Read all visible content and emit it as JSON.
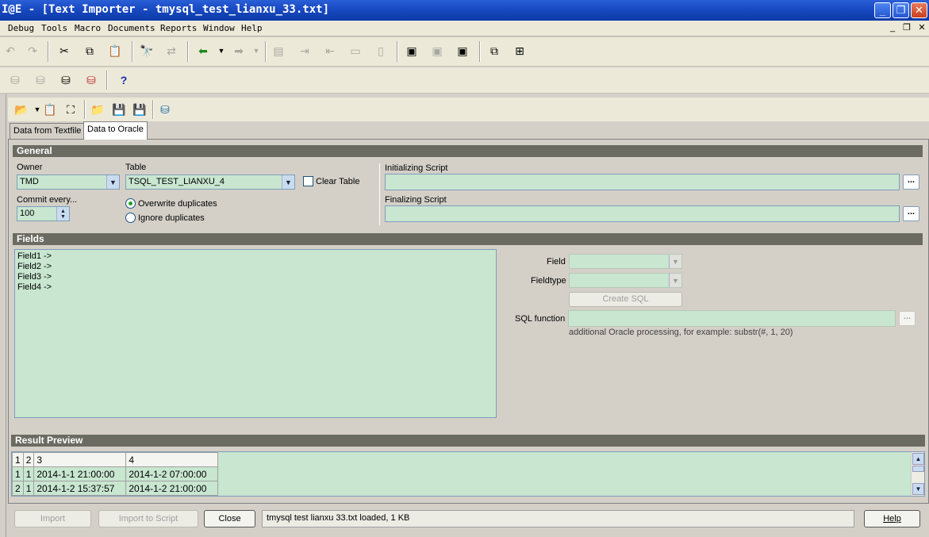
{
  "window": {
    "title": "E - [Text Importer - tmysql_test_lianxu_33.txt]",
    "title_prefix": "I@"
  },
  "menubar": {
    "items": [
      "Debug",
      "Tools",
      "Macro",
      "Documents",
      "Reports",
      "Window",
      "Help"
    ]
  },
  "tabs": [
    {
      "label": "Data from Textfile",
      "active": false
    },
    {
      "label": "Data to Oracle",
      "active": true
    }
  ],
  "general": {
    "header": "General",
    "owner_label": "Owner",
    "owner_value": "TMD",
    "table_label": "Table",
    "table_value": "TSQL_TEST_LIANXU_4",
    "clear_table_label": "Clear Table",
    "clear_table_checked": false,
    "commit_label": "Commit every...",
    "commit_value": "100",
    "overwrite_label": "Overwrite duplicates",
    "ignore_label": "Ignore duplicates",
    "duplicate_mode": "overwrite",
    "init_script_label": "Initializing Script",
    "init_script_value": "",
    "final_script_label": "Finalizing Script",
    "final_script_value": "",
    "ellipsis": "..."
  },
  "fields": {
    "header": "Fields",
    "list": [
      "Field1  ->",
      "Field2  ->",
      "Field3  ->",
      "Field4  ->"
    ],
    "field_label": "Field",
    "fieldtype_label": "Fieldtype",
    "create_sql_label": "Create SQL",
    "sql_function_label": "SQL function",
    "sql_hint": "additional Oracle processing, for example: substr(#, 1, 20)"
  },
  "result_preview": {
    "header": "Result Preview",
    "columns": [
      "1",
      "2",
      "3",
      "4"
    ],
    "rows": [
      [
        "1",
        "1",
        "2014-1-1 21:00:00",
        "2014-1-2 07:00:00"
      ],
      [
        "2",
        "1",
        "2014-1-2 15:37:57",
        "2014-1-2 21:00:00"
      ]
    ]
  },
  "footer": {
    "import_label": "Import",
    "import_script_label": "Import to Script",
    "close_label": "Close",
    "status": "tmysql  test  lianxu  33.txt loaded,  1 KB",
    "help_label": "Help"
  },
  "colors": {
    "field_bg": "#c8e6d0",
    "section_header": "#6b6b62",
    "titlebar": "#1a4bc4"
  }
}
